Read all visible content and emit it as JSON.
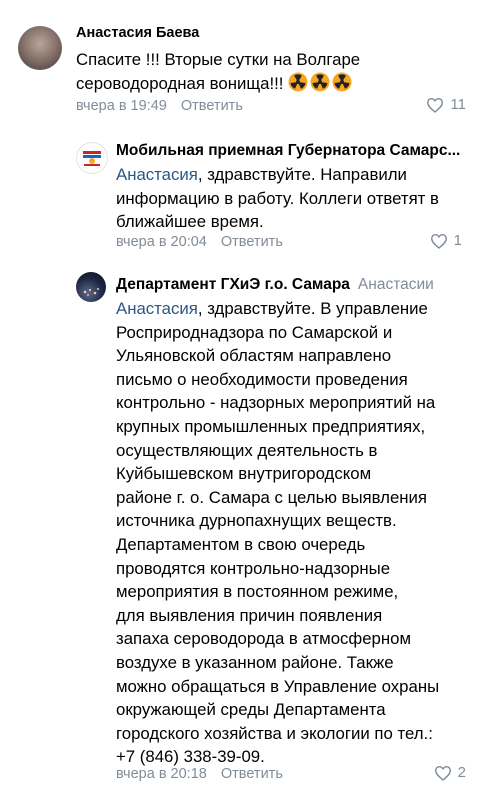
{
  "comments": [
    {
      "author": "Анастасия Баева",
      "lines": [
        "Спасите !!! Вторые сутки на Волгаре",
        "сероводородная вонища!!!"
      ],
      "time": "вчера в 19:49",
      "reply": "Ответить",
      "likes": "11",
      "emoji_icon": "radioactive-emoji"
    },
    {
      "author": "Мобильная приемная Губернатора Самарс...",
      "mention": "Анастасия",
      "lines": [
        ", здравствуйте. Направили",
        "информацию в работу. Коллеги ответят в",
        "ближайшее время."
      ],
      "time": "вчера в 20:04",
      "reply": "Ответить",
      "likes": "1"
    },
    {
      "author": "Департамент ГХиЭ г.о. Самара",
      "to": "Анастасии",
      "mention": "Анастасия",
      "lines": [
        ", здравствуйте. В управление",
        "Росприроднадзора по Самарской и",
        "Ульяновской областям направлено",
        "письмо о необходимости проведения",
        "контрольно - надзорных мероприятий на",
        "крупных промышленных предприятиях,",
        "осуществляющих деятельность в",
        "Куйбышевском внутригородском",
        "районе г. о. Самара с целью выявления",
        "источника дурнопахнущих веществ.",
        "Департаментом в свою очередь",
        "проводятся контрольно-надзорные",
        "мероприятия в постоянном режиме,",
        "для выявления причин появления",
        "запаха сероводорода в атмосферном",
        "воздухе в указанном районе. Также",
        "можно обращаться в Управление охраны",
        "окружающей среды Департамента",
        "городского хозяйства и экологии по тел.:",
        "+7 (846) 338-39-09."
      ],
      "time": "вчера в 20:18",
      "reply": "Ответить",
      "likes": "2"
    }
  ]
}
